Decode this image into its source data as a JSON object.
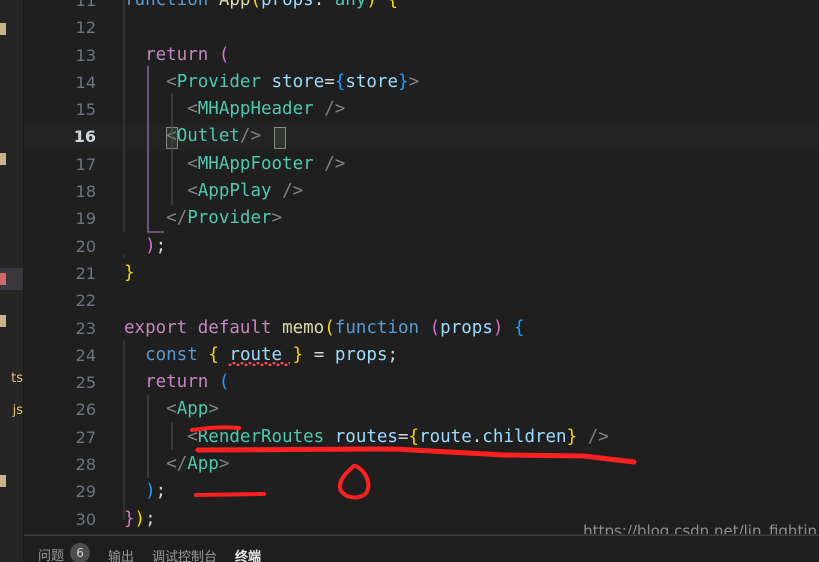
{
  "window": {
    "theme": "dark-plus",
    "background": "#1f1f1f",
    "accent": "#4ec9b0",
    "annotation_color": "#ff2020"
  },
  "explorer": {
    "items": [
      {
        "label": "",
        "marker": "folder-marker",
        "selected": false
      },
      {
        "label": "",
        "marker": "folder-marker",
        "selected": false
      },
      {
        "label": "",
        "marker": "modified-marker",
        "selected": true
      },
      {
        "label": "",
        "marker": "folder-marker",
        "selected": false
      },
      {
        "label": "ts",
        "marker": "file-ts",
        "selected": false
      },
      {
        "label": "js",
        "marker": "file-js",
        "selected": false
      },
      {
        "label": "",
        "marker": "folder-marker",
        "selected": false
      }
    ]
  },
  "editor": {
    "active_line": 16,
    "first_visible_line": 11,
    "last_visible_line": 30,
    "lines": [
      {
        "n": "11",
        "text": "function App(props: any) {"
      },
      {
        "n": "12",
        "text": ""
      },
      {
        "n": "13",
        "text": "  return ("
      },
      {
        "n": "14",
        "text": "    <Provider store={store}>"
      },
      {
        "n": "15",
        "text": "      <MHAppHeader />"
      },
      {
        "n": "16",
        "text": "    <Outlet/>"
      },
      {
        "n": "17",
        "text": "      <MHAppFooter />"
      },
      {
        "n": "18",
        "text": "      <AppPlay />"
      },
      {
        "n": "19",
        "text": "    </Provider>"
      },
      {
        "n": "20",
        "text": "  );"
      },
      {
        "n": "21",
        "text": "}"
      },
      {
        "n": "22",
        "text": ""
      },
      {
        "n": "23",
        "text": "export default memo(function (props) {"
      },
      {
        "n": "24",
        "text": "  const { route } = props;"
      },
      {
        "n": "25",
        "text": "  return ("
      },
      {
        "n": "26",
        "text": "    <App>"
      },
      {
        "n": "27",
        "text": "      <RenderRoutes routes={route.children} />"
      },
      {
        "n": "28",
        "text": "    </App>"
      },
      {
        "n": "29",
        "text": "  );"
      },
      {
        "n": "30",
        "text": "});"
      }
    ],
    "error_token": "route",
    "error_line": 24
  },
  "annotations": [
    {
      "name": "underline-app-open-tag",
      "shape": "short-underline",
      "target_line": 26
    },
    {
      "name": "underline-renderroutes-line",
      "shape": "long-wavy-underline",
      "target_line": 27
    },
    {
      "name": "blob-mark",
      "shape": "small-loop",
      "target_line": 28
    },
    {
      "name": "underline-closing-paren",
      "shape": "short-underline",
      "target_line": 29
    }
  ],
  "watermark": {
    "text": "https://blog.csdn.net/lin_fightin"
  },
  "panel": {
    "tabs": [
      {
        "label": "问题",
        "badge": "6",
        "active": false
      },
      {
        "label": "输出",
        "badge": "",
        "active": false
      },
      {
        "label": "调试控制台",
        "badge": "",
        "active": false
      },
      {
        "label": "终端",
        "badge": "",
        "active": true
      }
    ]
  }
}
